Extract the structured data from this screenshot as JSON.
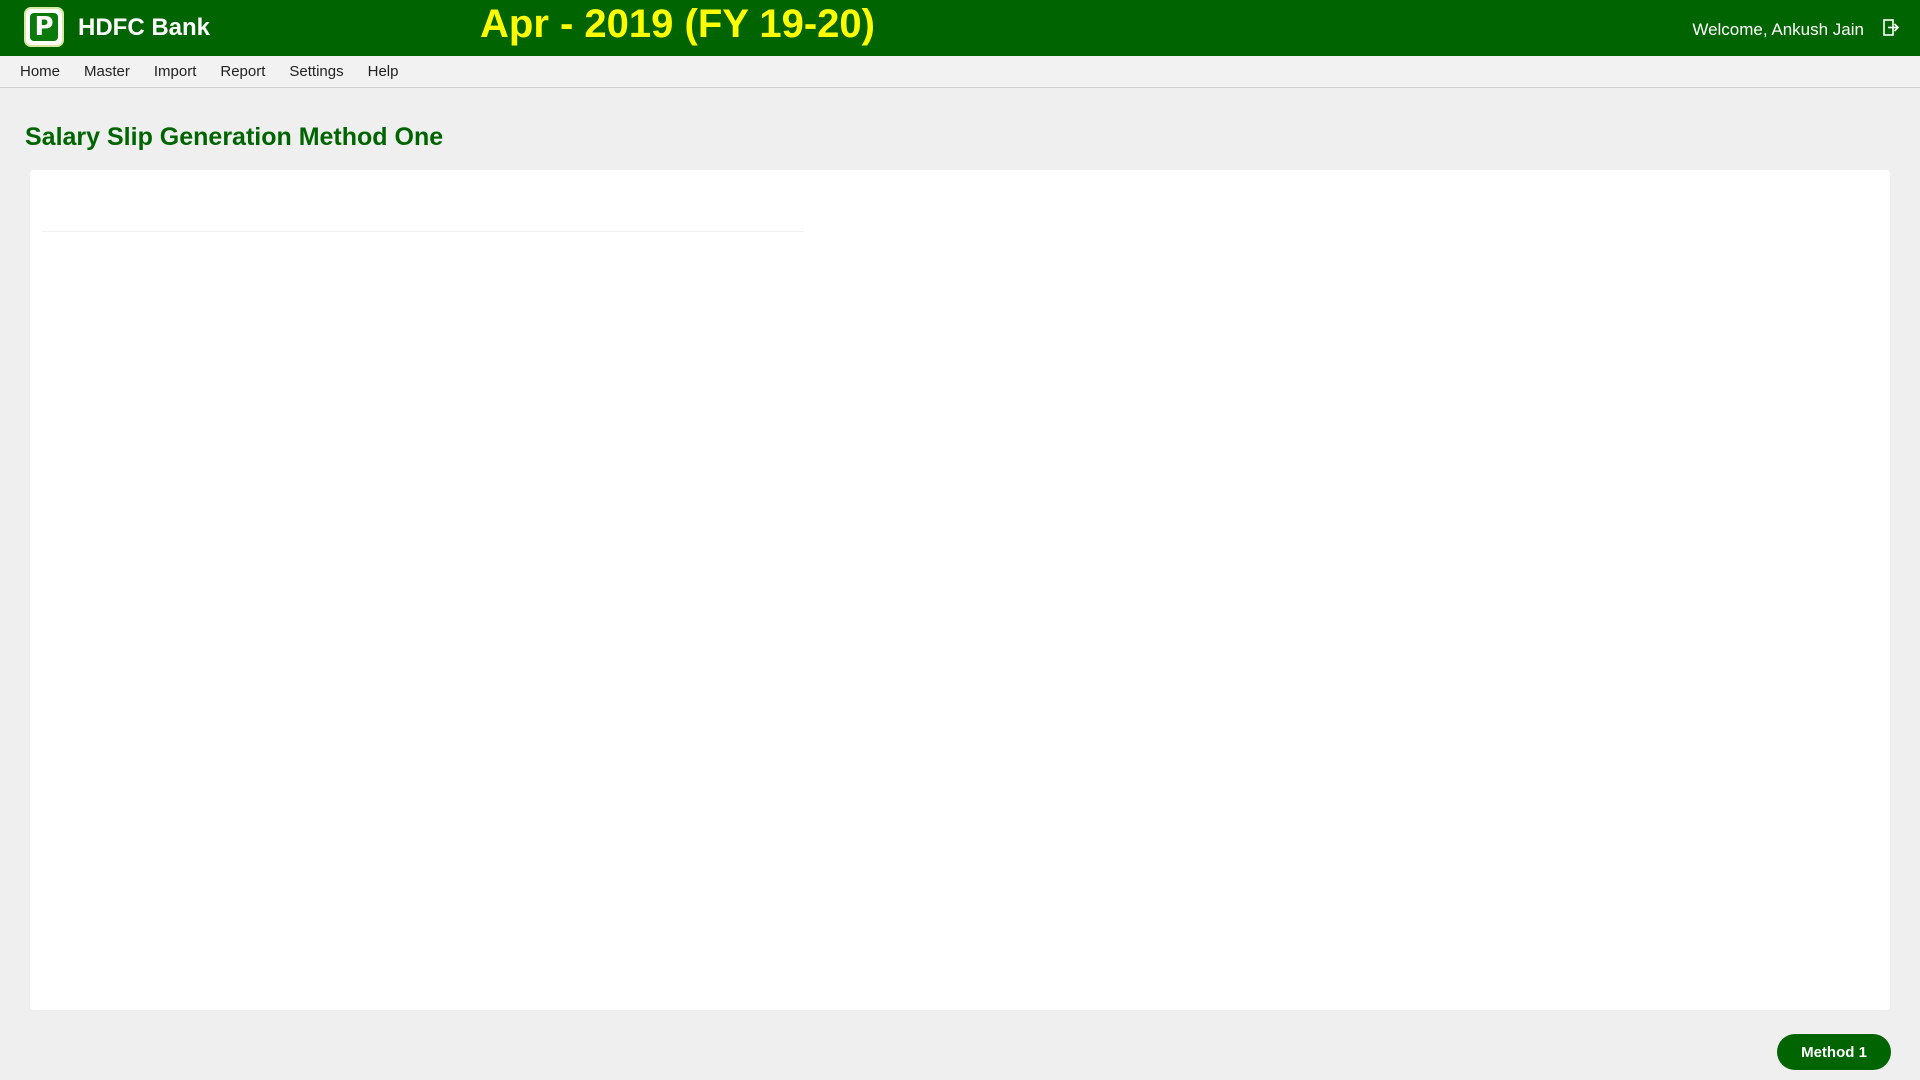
{
  "header": {
    "logo_letter": "P",
    "brand": "HDFC Bank",
    "period": "Apr - 2019 (FY 19-20)",
    "welcome": "Welcome, Ankush Jain",
    "logout_icon": "logout-icon",
    "colors": {
      "bar": "#006400",
      "period_text": "#ffff00",
      "text": "#ffffff"
    }
  },
  "menu": {
    "items": [
      {
        "label": "Home"
      },
      {
        "label": "Master"
      },
      {
        "label": "Import"
      },
      {
        "label": "Report"
      },
      {
        "label": "Settings"
      },
      {
        "label": "Help"
      }
    ]
  },
  "page": {
    "title": "Salary Slip Generation Method One"
  },
  "actions": {
    "method_button": "Method 1"
  }
}
